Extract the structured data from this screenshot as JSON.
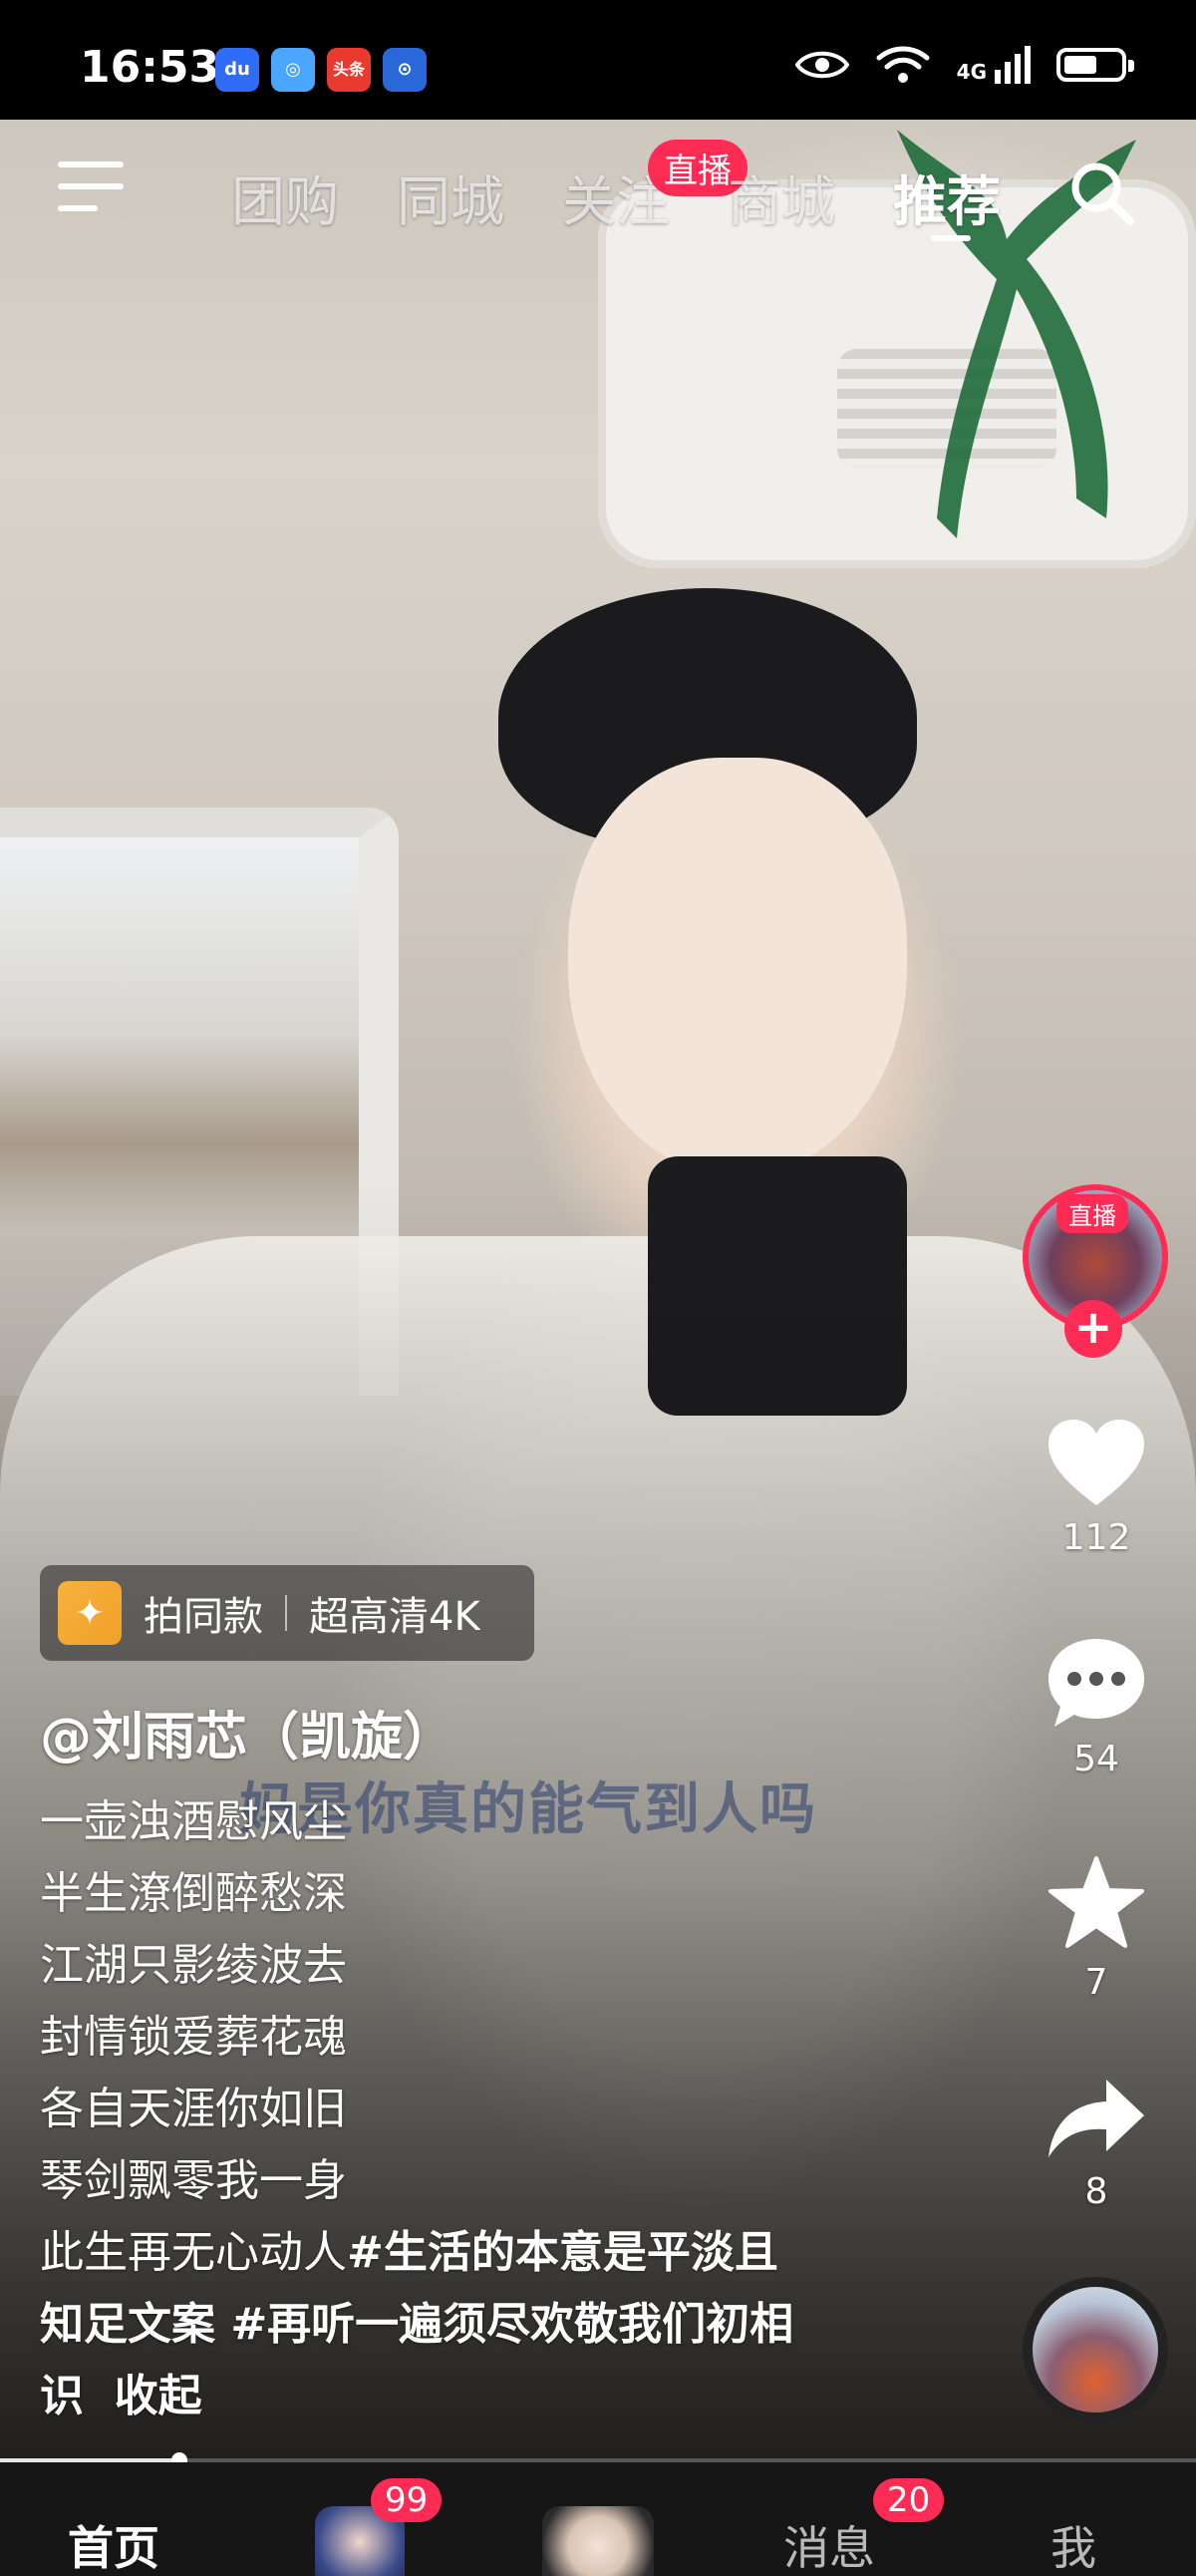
{
  "status_bar": {
    "time": "16:53",
    "app_icons": [
      {
        "name": "baidu-icon",
        "label": "du",
        "color": "#2f6df6"
      },
      {
        "name": "browser-icon",
        "label": "",
        "color": "#4aa6ff"
      },
      {
        "name": "toutiao-icon",
        "label": "头条",
        "color": "#e93a30"
      },
      {
        "name": "app-icon",
        "label": "",
        "color": "#2a67d9"
      }
    ],
    "network": "4G"
  },
  "top_nav": {
    "tabs": [
      "团购",
      "同城",
      "关注",
      "商城",
      "推荐"
    ],
    "active_tab": "推荐",
    "live_badge": "直播"
  },
  "video_overlay_text": "妈是你真的能气到人吗",
  "right_rail": {
    "avatar_live_label": "直播",
    "follow_symbol": "+",
    "likes": "112",
    "comments": "54",
    "favorites": "7",
    "shares": "8"
  },
  "feature_chip": {
    "label1": "拍同款",
    "label2": "超高清4K"
  },
  "author": "@刘雨芯（凯旋）",
  "description": {
    "lines": [
      "一壶浊酒慰风尘",
      "半生潦倒醉愁深",
      "江湖只影绫波去",
      "封情锁爱葬花魂",
      "各自天涯你如旧",
      "琴剑飘零我一身"
    ],
    "line7_plain": "此生再无心动人",
    "line7_tag": "#生活的本意是平淡且",
    "line8": "知足文案 #再听一遍须尽欢敬我们初相",
    "line9_text": "识",
    "collapse": "收起"
  },
  "playback_progress": 0.15,
  "bottom_bar": {
    "home": "首页",
    "friends_badge": "99",
    "messages": "消息",
    "messages_badge": "20",
    "me": "我"
  },
  "colors": {
    "accent": "#fe2c55",
    "bottom_bar": "#161616"
  }
}
